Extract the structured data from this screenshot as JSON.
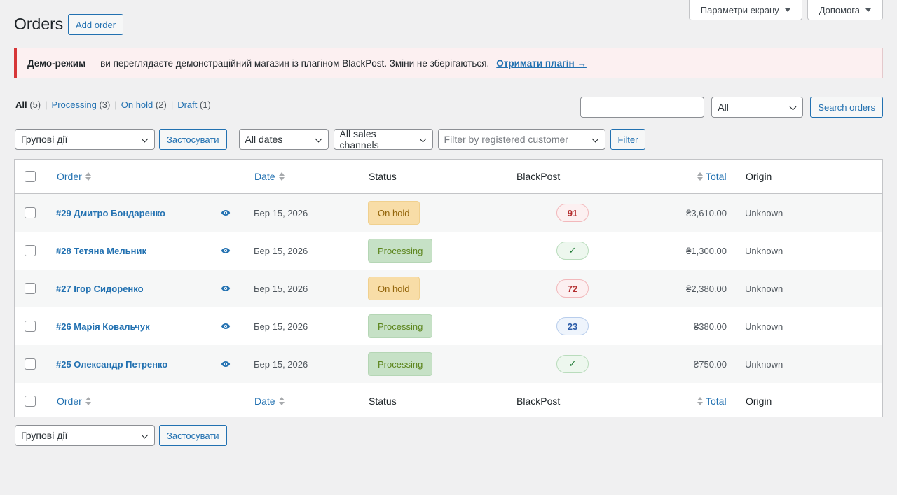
{
  "header": {
    "title": "Orders",
    "add_order": "Add order",
    "screen_options": "Параметри екрану",
    "help": "Допомога"
  },
  "notice": {
    "bold": "Демо-режим",
    "text": " — ви переглядаєте демонстраційний магазин із плагіном BlackPost. Зміни не зберігаються.",
    "link": "Отримати плагін →"
  },
  "views": [
    {
      "label": "All",
      "count": "(5)"
    },
    {
      "label": "Processing",
      "count": "(3)"
    },
    {
      "label": "On hold",
      "count": "(2)"
    },
    {
      "label": "Draft",
      "count": "(1)"
    }
  ],
  "search": {
    "value": "",
    "status_select": "All",
    "button": "Search orders"
  },
  "filters": {
    "bulk_actions": "Групові дії",
    "apply": "Застосувати",
    "dates": "All dates",
    "channels": "All sales channels",
    "customer_placeholder": "Filter by registered customer",
    "filter_button": "Filter"
  },
  "columns": {
    "order": "Order",
    "date": "Date",
    "status": "Status",
    "blackpost": "BlackPost",
    "total": "Total",
    "origin": "Origin"
  },
  "orders": [
    {
      "title": "#29 Дмитро Бондаренко",
      "date": "Бер 15, 2026",
      "status": "On hold",
      "status_kind": "hold",
      "blackpost": "91",
      "bp_kind": "red",
      "total": "₴3,610.00",
      "origin": "Unknown"
    },
    {
      "title": "#28 Тетяна Мельник",
      "date": "Бер 15, 2026",
      "status": "Processing",
      "status_kind": "proc",
      "blackpost": "✓",
      "bp_kind": "green",
      "total": "₴1,300.00",
      "origin": "Unknown"
    },
    {
      "title": "#27 Ігор Сидоренко",
      "date": "Бер 15, 2026",
      "status": "On hold",
      "status_kind": "hold",
      "blackpost": "72",
      "bp_kind": "red",
      "total": "₴2,380.00",
      "origin": "Unknown"
    },
    {
      "title": "#26 Марія Ковальчук",
      "date": "Бер 15, 2026",
      "status": "Processing",
      "status_kind": "proc",
      "blackpost": "23",
      "bp_kind": "blue",
      "total": "₴380.00",
      "origin": "Unknown"
    },
    {
      "title": "#25 Олександр Петренко",
      "date": "Бер 15, 2026",
      "status": "Processing",
      "status_kind": "proc",
      "blackpost": "✓",
      "bp_kind": "green",
      "total": "₴750.00",
      "origin": "Unknown"
    }
  ],
  "colors": {
    "accent": "#2271b1",
    "notice_border": "#d63638",
    "on_hold_bg": "#f8dda7",
    "processing_bg": "#c6e1c6"
  }
}
